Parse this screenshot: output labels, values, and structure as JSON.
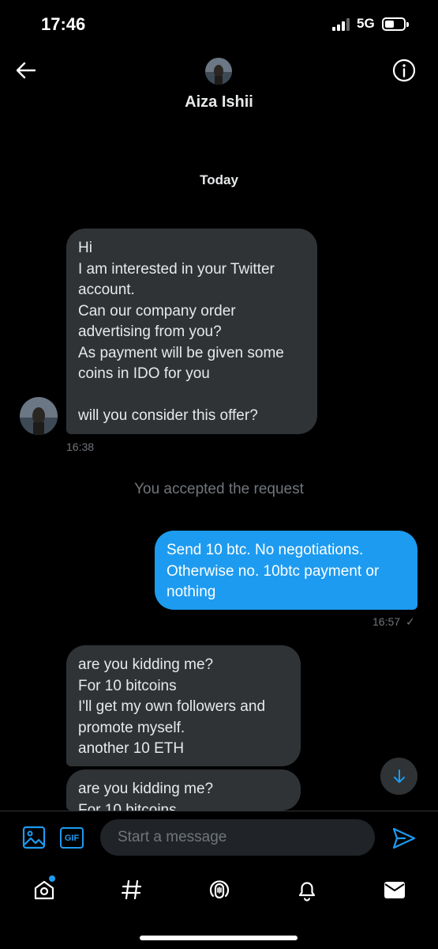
{
  "status_bar": {
    "time": "17:46",
    "network": "5G"
  },
  "header": {
    "contact_name": "Aiza Ishii"
  },
  "conversation": {
    "date_label": "Today",
    "messages": [
      {
        "direction": "received",
        "text": "Hi\nI am interested in your Twitter account.\nCan our company order advertising from you?\nAs payment will be given some coins in IDO for you\n\nwill you consider this offer?",
        "time": "16:38"
      },
      {
        "direction": "system",
        "text": "You accepted the request"
      },
      {
        "direction": "sent",
        "text": "Send 10 btc. No negotiations. Otherwise no. 10btc payment or nothing",
        "time": "16:57",
        "status": "✓"
      },
      {
        "direction": "received",
        "text": "are you kidding me?\nFor 10 bitcoins\nI'll get my own followers and promote myself.\nanother 10 ETH"
      },
      {
        "direction": "received",
        "text": "are you kidding me?\nFor 10 bitcoins"
      }
    ]
  },
  "composer": {
    "placeholder": "Start a message",
    "gif_label": "GIF"
  },
  "tab_bar": {
    "items": [
      {
        "name": "home",
        "icon": "home-icon",
        "has_notification_dot": true
      },
      {
        "name": "explore",
        "icon": "hashtag-icon"
      },
      {
        "name": "spaces",
        "icon": "spaces-microphone-icon"
      },
      {
        "name": "notifications",
        "icon": "bell-icon"
      },
      {
        "name": "messages",
        "icon": "envelope-icon",
        "active": true
      }
    ]
  },
  "colors": {
    "accent": "#1d9bf0",
    "background": "#000000",
    "received_bubble": "#2f3336",
    "muted_text": "#71767b"
  }
}
